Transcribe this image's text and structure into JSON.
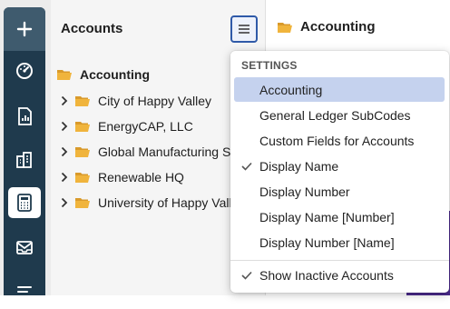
{
  "nav": {
    "items": [
      {
        "icon": "plus-icon"
      },
      {
        "icon": "dashboard-gauge-icon"
      },
      {
        "icon": "report-icon"
      },
      {
        "icon": "buildings-icon"
      },
      {
        "icon": "calculator-icon"
      },
      {
        "icon": "mail-inbox-icon"
      },
      {
        "icon": "list-icon"
      }
    ],
    "active_index": 4
  },
  "panel": {
    "title": "Accounts",
    "menu_icon": "hamburger-menu-icon",
    "root": {
      "label": "Accounting",
      "icon": "folder-open-icon"
    },
    "items": [
      {
        "label": "City of Happy Valley"
      },
      {
        "label": "EnergyCAP, LLC"
      },
      {
        "label": "Global Manufacturing Solutions"
      },
      {
        "label": "Renewable HQ"
      },
      {
        "label": "University of Happy Valley"
      }
    ]
  },
  "right": {
    "title": "Accounting",
    "icon": "folder-open-icon"
  },
  "dropdown": {
    "header": "SETTINGS",
    "items": [
      {
        "label": "Accounting",
        "checked": false,
        "selected": true
      },
      {
        "label": "General Ledger SubCodes",
        "checked": false,
        "selected": false
      },
      {
        "label": "Custom Fields for Accounts",
        "checked": false,
        "selected": false
      },
      {
        "label": "Display Name",
        "checked": true,
        "selected": false
      },
      {
        "label": "Display Number",
        "checked": false,
        "selected": false
      },
      {
        "label": "Display Name [Number]",
        "checked": false,
        "selected": false
      },
      {
        "label": "Display Number [Name]",
        "checked": false,
        "selected": false
      }
    ],
    "footer_item": {
      "label": "Show Inactive Accounts",
      "checked": true
    }
  },
  "colors": {
    "rail": "#1f3a4d",
    "folder": "#f0b43c",
    "selected_bg": "#c5d2ee",
    "accent_border": "#2f5aa8",
    "purple": "#4a2a8c"
  }
}
